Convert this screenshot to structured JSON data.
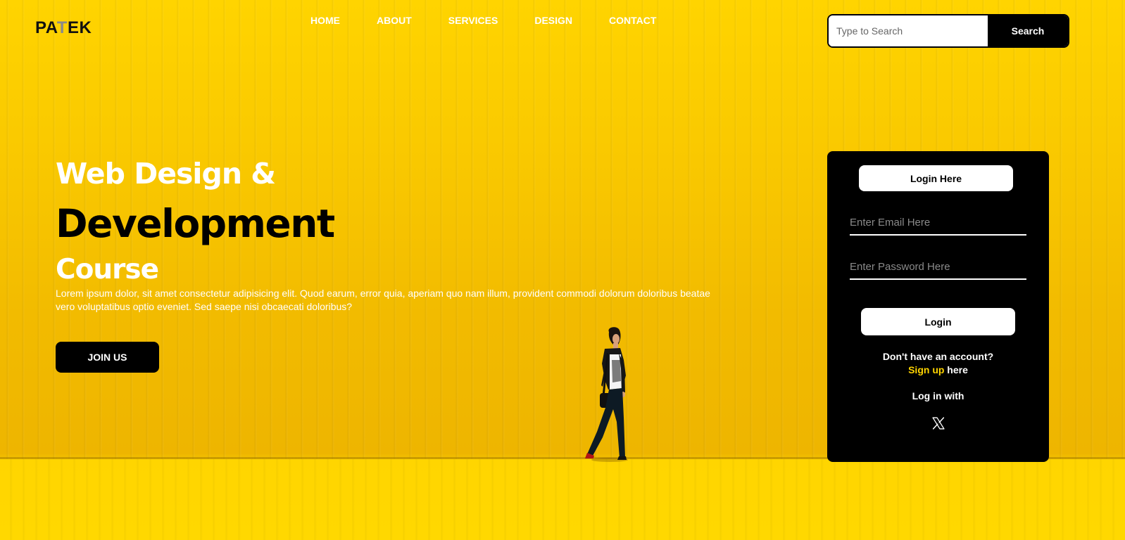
{
  "header": {
    "logo": {
      "part1": "PA",
      "part2": "T",
      "part3": "EK"
    },
    "nav": [
      "HOME",
      "ABOUT",
      "SERVICES",
      "DESIGN",
      "CONTACT"
    ],
    "search": {
      "placeholder": "Type to Search",
      "button_label": "Search"
    }
  },
  "hero": {
    "line1": "Web Design &",
    "line2": "Development",
    "line3": "Course",
    "description": "Lorem ipsum dolor, sit amet consectetur adipisicing elit. Quod earum, error quia, aperiam quo nam illum, provident commodi dolorum doloribus beatae vero voluptatibus optio eveniet. Sed saepe nisi obcaecati doloribus?",
    "cta_label": "JOIN US"
  },
  "login": {
    "title": "Login Here",
    "email_placeholder": "Enter Email Here",
    "password_placeholder": "Enter Password Here",
    "submit_label": "Login",
    "no_account": "Don't have an account?",
    "signup_link": "Sign up",
    "signup_suffix": " here",
    "login_with": "Log in with",
    "social_icon": "x-icon"
  },
  "colors": {
    "background": "#f7c400",
    "panel": "#000000",
    "accent": "#ffd400"
  }
}
